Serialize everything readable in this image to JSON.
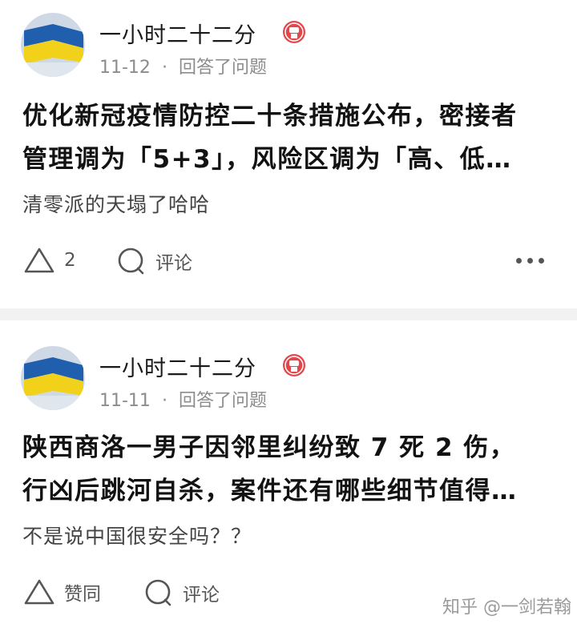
{
  "feed": [
    {
      "author": "一小时二十二分",
      "date": "11-12",
      "separator": "·",
      "action": "回答了问题",
      "title_lines": [
        "优化新冠疫情防控二十条措施公布，密接者",
        "管理调为「5+3」，风险区调为「高、低…"
      ],
      "excerpt": "清零派的天塌了哈哈",
      "vote_label": "2",
      "comment_label": "评论",
      "vote_icon": "triangle-up-icon",
      "comment_icon": "comment-bubble-icon",
      "more_icon": "ellipsis-icon"
    },
    {
      "author": "一小时二十二分",
      "date": "11-11",
      "separator": "·",
      "action": "回答了问题",
      "title_lines": [
        "陕西商洛一男子因邻里纠纷致 7 死 2 伤，",
        "行凶后跳河自杀，案件还有哪些细节值得…"
      ],
      "excerpt": "不是说中国很安全吗？？",
      "vote_label": "赞同",
      "comment_label": "评论",
      "vote_icon": "triangle-up-icon",
      "comment_icon": "comment-bubble-icon"
    }
  ],
  "watermark": "知乎 @一剑若翰",
  "colors": {
    "flag_blue": "#1f5fae",
    "flag_yellow": "#f2d11a",
    "badge_red": "#e2474c",
    "divider": "#f2f2f2"
  }
}
